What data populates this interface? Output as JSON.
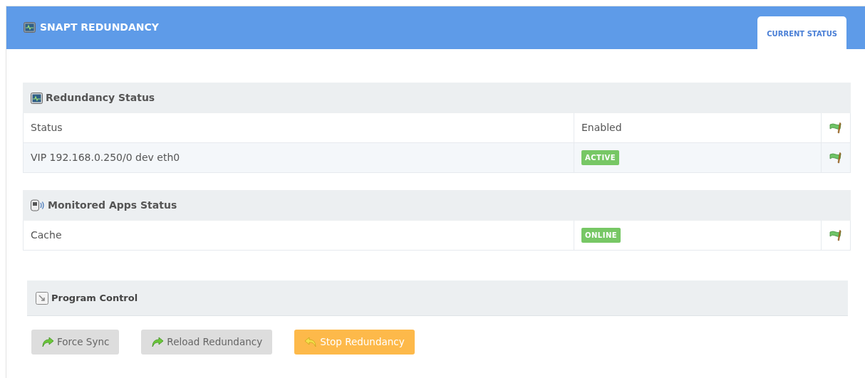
{
  "header": {
    "title": "SNAPT REDUNDANCY"
  },
  "tabs": [
    {
      "label": "CURRENT STATUS",
      "selected": true
    }
  ],
  "sections": [
    {
      "title": "Redundancy Status",
      "kind": "monitor",
      "rows": [
        {
          "label": "Status",
          "kind": "text",
          "value": "Enabled"
        },
        {
          "label": "VIP 192.168.0.250/0 dev eth0",
          "kind": "badge",
          "value": "ACTIVE"
        }
      ]
    },
    {
      "title": "Monitored Apps Status",
      "kind": "device",
      "rows": [
        {
          "label": "Cache",
          "kind": "badge",
          "value": "ONLINE"
        }
      ]
    }
  ],
  "program_control": {
    "title": "Program Control",
    "buttons": [
      {
        "label": "Force Sync",
        "kind": "default"
      },
      {
        "label": "Reload Redundancy",
        "kind": "default"
      },
      {
        "label": "Stop Redundancy",
        "kind": "warning"
      }
    ]
  }
}
